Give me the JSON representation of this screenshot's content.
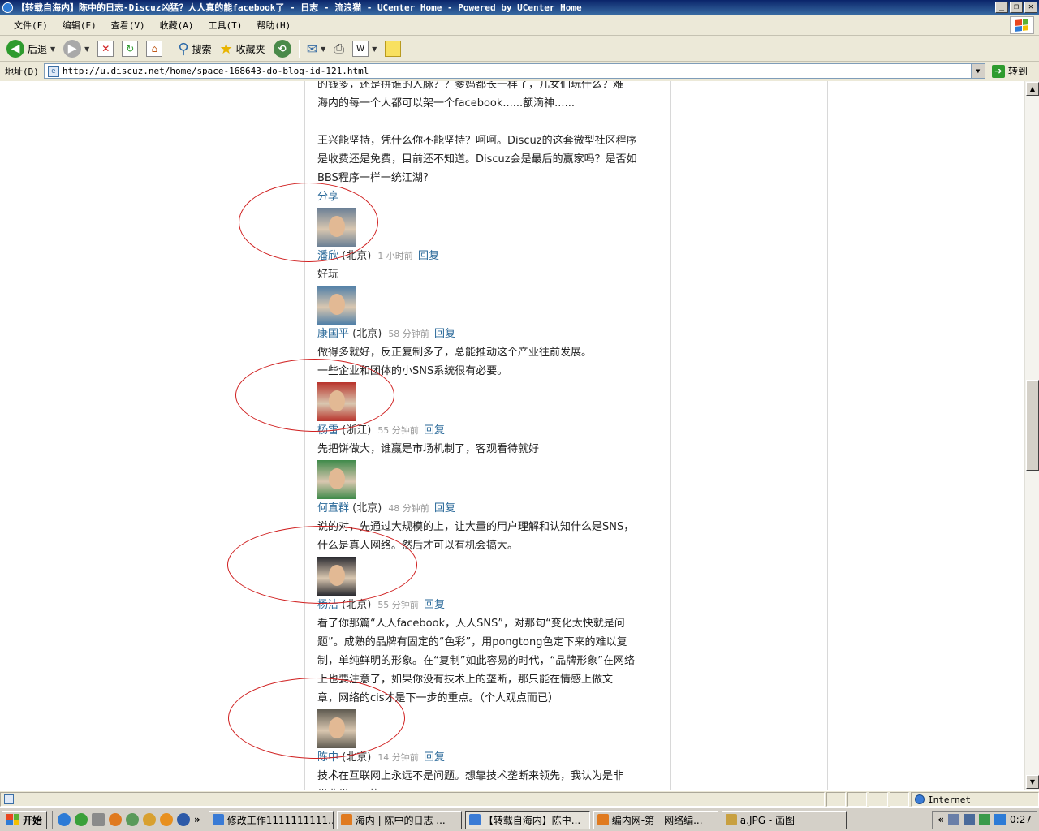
{
  "window": {
    "title": "【转载自海内】陈中的日志-Discuz凶猛？人人真的能facebook了 - 日志 - 流浪猫 - UCenter Home - Powered by UCenter Home"
  },
  "menu": [
    "文件(F)",
    "编辑(E)",
    "查看(V)",
    "收藏(A)",
    "工具(T)",
    "帮助(H)"
  ],
  "toolbar": {
    "back": "后退",
    "search": "搜索",
    "favorites": "收藏夹"
  },
  "address": {
    "label": "地址(D)",
    "url": "http://u.discuz.net/home/space-168643-do-blog-id-121.html",
    "go": "转到"
  },
  "article": {
    "lines": [
      "的钱多，还是拼谁的人脉？？爹妈都长一样了，儿女们玩什么？难",
      "海内的每一个人都可以架一个facebook......额滴神......",
      "",
      "王兴能坚持，凭什么你不能坚持？呵呵。Discuz的这套微型社区程序",
      "是收费还是免费，目前还不知道。Discuz会是最后的赢家吗？是否如",
      "BBS程序一样一统江湖?"
    ],
    "share": "分享"
  },
  "comments": [
    {
      "name": "潘欣",
      "loc": "(北京)",
      "time": "1 小时前",
      "reply": "回复",
      "lines": [
        "好玩"
      ],
      "avatar_color": "#6a7f95"
    },
    {
      "name": "康国平",
      "loc": "(北京)",
      "time": "58 分钟前",
      "reply": "回复",
      "lines": [
        "做得多就好，反正复制多了，总能推动这个产业往前发展。",
        "一些企业和团体的小SNS系统很有必要。"
      ],
      "avatar_color": "#4f7fa8"
    },
    {
      "name": "杨雷",
      "loc": "(浙江)",
      "time": "55 分钟前",
      "reply": "回复",
      "lines": [
        "先把饼做大，谁赢是市场机制了，客观看待就好"
      ],
      "avatar_color": "#b8322a"
    },
    {
      "name": "何直群",
      "loc": "(北京)",
      "time": "48 分钟前",
      "reply": "回复",
      "lines": [
        "说的对，先通过大规模的上，让大量的用户理解和认知什么是SNS，",
        "什么是真人网络。然后才可以有机会搞大。"
      ],
      "avatar_color": "#3f8a4a"
    },
    {
      "name": "杨洁",
      "loc": "(北京)",
      "time": "55 分钟前",
      "reply": "回复",
      "lines": [
        "看了你那篇“人人facebook，人人SNS”，对那句“变化太快就是问",
        "题”。成熟的品牌有固定的“色彩”，用pongtong色定下来的难以复",
        "制，单纯鲜明的形象。在“复制”如此容易的时代，“品牌形象”在网络",
        "上也要注意了，如果你没有技术上的垄断，那只能在情感上做文",
        "章，网络的cis才是下一步的重点。（个人观点而已）"
      ],
      "avatar_color": "#2a2a30"
    },
    {
      "name": "陈中",
      "loc": "(北京)",
      "time": "14 分钟前",
      "reply": "回复",
      "lines": [
        "技术在互联网上永远不是问题。想靠技术垄断来领先，我认为是非",
        "常非常......的"
      ],
      "avatar_color": "#5e5a50"
    }
  ],
  "status": {
    "zone": "Internet"
  },
  "taskbar": {
    "start": "开始",
    "tasks": [
      {
        "label": "修改工作1111111111...",
        "active": false,
        "color": "#3a7bd5"
      },
      {
        "label": "海内 | 陈中的日志 ...",
        "active": false,
        "color": "#e07a1f"
      },
      {
        "label": "【转载自海内】陈中...",
        "active": true,
        "color": "#3a7bd5"
      },
      {
        "label": "编内网-第一网络编...",
        "active": false,
        "color": "#e07a1f"
      },
      {
        "label": "a.JPG - 画图",
        "active": false,
        "color": "#c8a040"
      }
    ],
    "clock": "0:27"
  }
}
